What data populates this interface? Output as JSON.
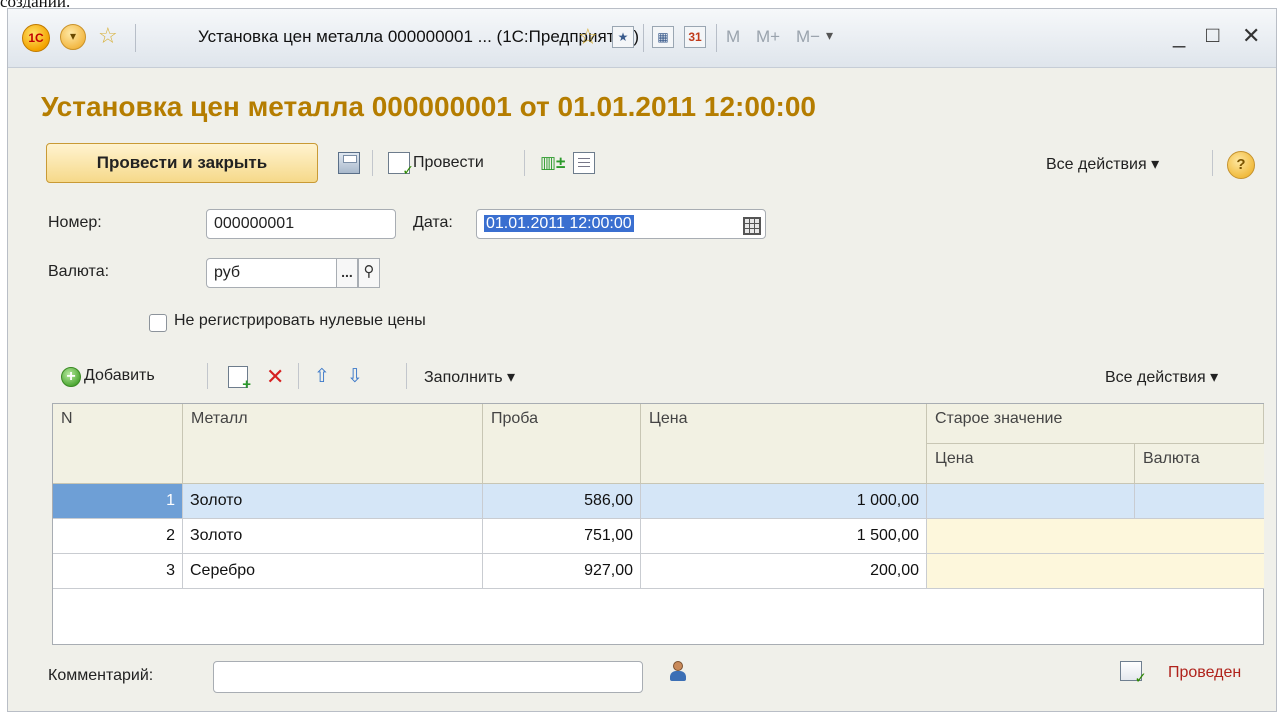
{
  "above_text": "создании.",
  "window": {
    "title": "Установка цен металла 000000001 ... (1С:Предприятие)",
    "logo_text": "1С",
    "mem_keys": [
      "M",
      "M+",
      "M−"
    ],
    "controls": {
      "minimize": "_",
      "maximize": "□",
      "close": "✕"
    }
  },
  "document": {
    "title": "Установка цен металла 000000001 от 01.01.2011 12:00:00"
  },
  "toolbar": {
    "post_close_label": "Провести и закрыть",
    "post_label": "Провести",
    "all_actions_label": "Все действия ▾",
    "help_label": "?"
  },
  "form": {
    "number_label": "Номер:",
    "number_value": "000000001",
    "date_label": "Дата:",
    "date_value": "01.01.2011 12:00:00",
    "currency_label": "Валюта:",
    "currency_value": "руб",
    "currency_pick": "...",
    "zero_prices_label": "Не регистрировать нулевые цены"
  },
  "table_toolbar": {
    "add_label": "Добавить",
    "fill_label": "Заполнить ▾",
    "all_actions_label": "Все действия ▾"
  },
  "table": {
    "headers": {
      "n": "N",
      "metal": "Металл",
      "proba": "Проба",
      "price": "Цена",
      "old_value": "Старое значение",
      "old_price": "Цена",
      "old_currency": "Валюта"
    },
    "rows": [
      {
        "n": "1",
        "metal": "Золото",
        "proba": "586,00",
        "price": "1 000,00",
        "old_price": "",
        "old_currency": ""
      },
      {
        "n": "2",
        "metal": "Золото",
        "proba": "751,00",
        "price": "1 500,00",
        "old_price": "",
        "old_currency": ""
      },
      {
        "n": "3",
        "metal": "Серебро",
        "proba": "927,00",
        "price": "200,00",
        "old_price": "",
        "old_currency": ""
      }
    ]
  },
  "footer": {
    "comment_label": "Комментарий:",
    "comment_value": "",
    "status_label": "Проведен"
  }
}
